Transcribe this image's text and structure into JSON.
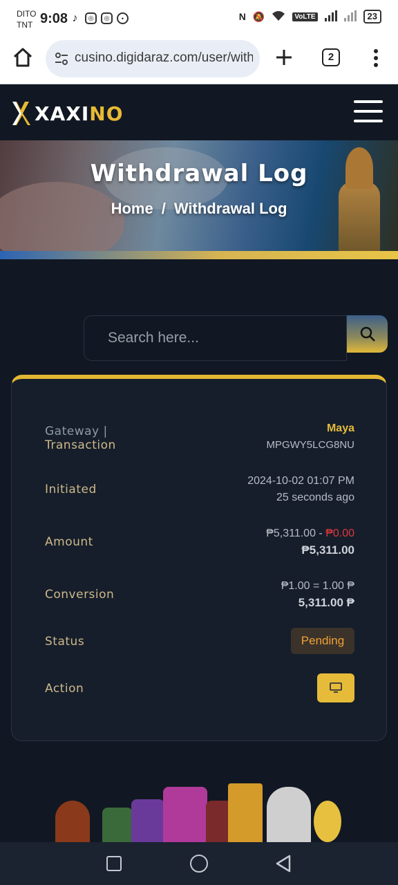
{
  "status_bar": {
    "carrier_line1": "DITO",
    "carrier_line2": "TNT",
    "time": "9:08",
    "battery": "23",
    "network": "VoLTE"
  },
  "browser": {
    "url": "cusino.digidaraz.com/user/with",
    "tab_count": "2"
  },
  "site": {
    "logo_white": "XAXI",
    "logo_gold": "NO"
  },
  "hero": {
    "title": "Withdrawal Log",
    "breadcrumb_home": "Home",
    "breadcrumb_sep": "/",
    "breadcrumb_current": "Withdrawal Log"
  },
  "search": {
    "placeholder": "Search here..."
  },
  "record": {
    "gateway_label_1": "Gateway |",
    "gateway_label_2": "Transaction",
    "gateway_name": "Maya",
    "transaction_id": "MPGWY5LCG8NU",
    "initiated_label": "Initiated",
    "initiated_date": "2024-10-02 01:07 PM",
    "initiated_ago": "25 seconds ago",
    "amount_label": "Amount",
    "amount_value": "₱5,311.00",
    "amount_dash": " - ",
    "amount_charge": "₱0.00",
    "amount_total": "₱5,311.00",
    "conversion_label": "Conversion",
    "conversion_rate": "₱1.00 = 1.00 ₱",
    "conversion_total": "5,311.00 ₱",
    "status_label": "Status",
    "status_value": "Pending",
    "action_label": "Action"
  },
  "colors": {
    "accent_gold": "#e6bb3a",
    "background": "#111823",
    "card": "#161e2b",
    "pending_text": "#f0a234",
    "charge_red": "#e0373b"
  },
  "icons": {
    "home": "home-icon",
    "site_settings": "site-settings-icon",
    "new_tab": "plus-icon",
    "overflow": "kebab-menu-icon",
    "menu": "hamburger-icon",
    "search": "search-icon",
    "action": "monitor-icon"
  }
}
